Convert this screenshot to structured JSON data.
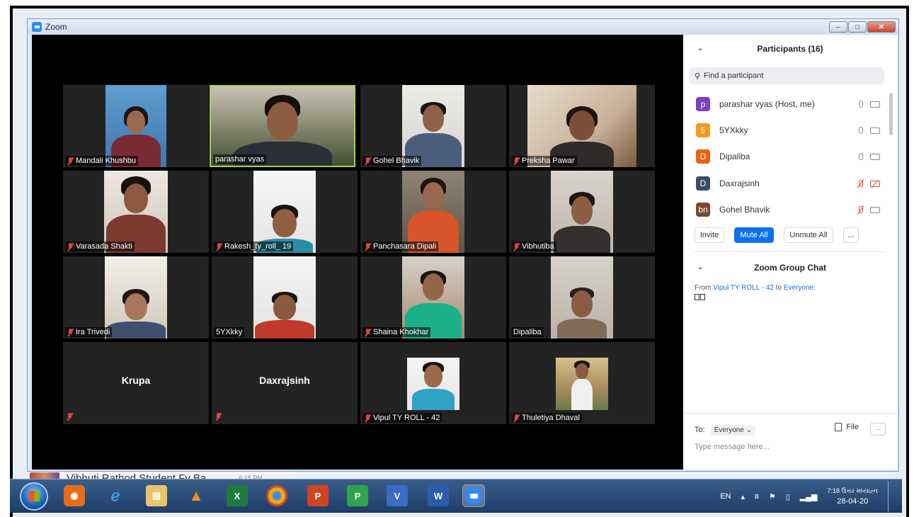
{
  "window": {
    "title": "Zoom",
    "minimize": "–",
    "maximize": "□",
    "close": "✕"
  },
  "tiles": [
    {
      "name": "Mandali Khushbu",
      "muted": true
    },
    {
      "name": "parashar vyas",
      "muted": false,
      "active": true
    },
    {
      "name": "Gohel Bhavik",
      "muted": true
    },
    {
      "name": "Preksha Pawar",
      "muted": true
    },
    {
      "name": "Varasada Shakti",
      "muted": true
    },
    {
      "name": "Rakesh_ty_roll_ 19",
      "muted": true
    },
    {
      "name": "Panchasara Dipali",
      "muted": true
    },
    {
      "name": "Vibhutiba",
      "muted": true
    },
    {
      "name": "Ira Trivedi",
      "muted": true
    },
    {
      "name": "5YXkky",
      "muted": false
    },
    {
      "name": "Shaina Khokhar",
      "muted": true
    },
    {
      "name": "Dipaliba",
      "muted": false
    },
    {
      "name": "Krupa",
      "muted": true,
      "no_video": true
    },
    {
      "name": "Daxrajsinh",
      "muted": true,
      "no_video": true
    },
    {
      "name": "Vipul TY ROLL - 42",
      "muted": true
    },
    {
      "name": "Thuletiya Dhaval",
      "muted": true
    }
  ],
  "participants": {
    "title": "Participants (16)",
    "search_placeholder": "Find a participant",
    "list": [
      {
        "initials": "p",
        "name": "parashar vyas (Host, me)",
        "color": "#7b3fc4",
        "mic_off": false,
        "cam_off": false
      },
      {
        "initials": "5",
        "name": "5YXkky",
        "color": "#f59a1b",
        "mic_off": false,
        "cam_off": false
      },
      {
        "initials": "D",
        "name": "Dipaliba",
        "color": "#e8620c",
        "mic_off": false,
        "cam_off": false
      },
      {
        "initials": "D",
        "name": "Daxrajsinh",
        "color": "#3a4d66",
        "mic_off": true,
        "cam_off": true
      },
      {
        "initials": "bn",
        "name": "Gohel Bhavik",
        "color": "#7a4a2e",
        "mic_off": true,
        "cam_off": false
      }
    ],
    "invite": "Invite",
    "mute_all": "Mute All",
    "unmute_all": "Unmute All",
    "more": "..."
  },
  "chat": {
    "title": "Zoom Group Chat",
    "from_label": "From",
    "from_name": "Vipul TY ROLL - 42",
    "to_label": "to",
    "to_name": "Everyone:",
    "to_prefix": "To:",
    "to_value": "Everyone ⌄",
    "file": "File",
    "more": "···",
    "placeholder": "Type message here..."
  },
  "background_window": {
    "text": "Vibhuti Rathod Student Fy Ba",
    "time": "6:15 PM"
  },
  "taskbar": {
    "lang": "EN",
    "time": "7:18 ઉત્તર મધ્યાહ્ન",
    "date": "28-04-20"
  },
  "colors": {
    "accent": "#0e71eb",
    "muted": "#e0453a",
    "active_border": "#a9d24a"
  }
}
